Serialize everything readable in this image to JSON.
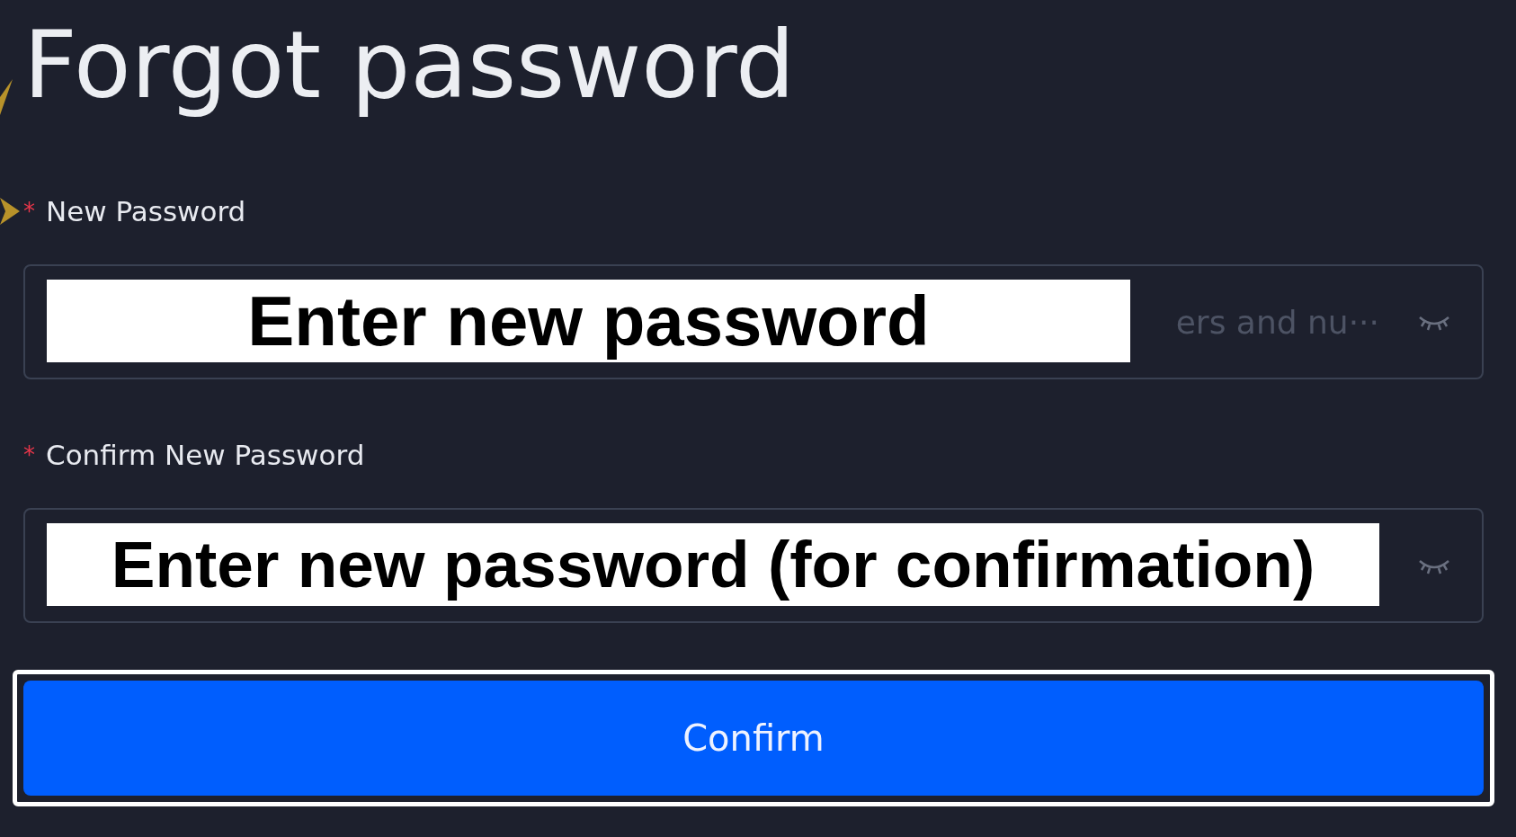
{
  "title": "Forgot password",
  "fields": [
    {
      "label": "New Password",
      "required_mark": "*",
      "placeholder": "ers and nu···",
      "password_visible": false,
      "overlay_label": "Enter new password"
    },
    {
      "label": "Confirm New Password",
      "required_mark": "*",
      "password_visible": false,
      "overlay_label": "Enter new password (for confirmation)"
    }
  ],
  "button": {
    "label": "Confirm",
    "highlighted": true
  }
}
